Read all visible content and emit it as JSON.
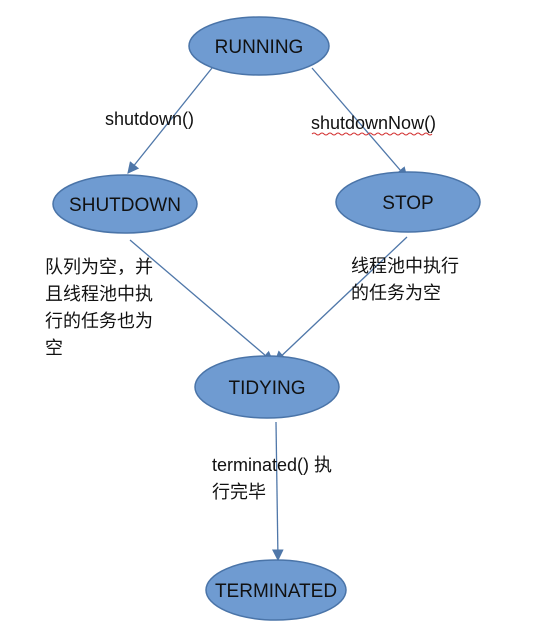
{
  "diagram": {
    "nodes": {
      "running": "RUNNING",
      "shutdown": "SHUTDOWN",
      "stop": "STOP",
      "tidying": "TIDYING",
      "terminated": "TERMINATED"
    },
    "edges": {
      "running_to_shutdown": "shutdown()",
      "running_to_stop": "shutdownNow()",
      "shutdown_to_tidying": [
        "队列为空，并",
        "且线程池中执",
        "行的任务也为",
        "空"
      ],
      "stop_to_tidying": [
        "线程池中执行",
        "的任务为空"
      ],
      "tidying_to_terminated": [
        "terminated() 执",
        "行完毕"
      ]
    },
    "colors": {
      "node_fill": "#6f9bd1",
      "node_stroke": "#4a74a8",
      "edge": "#4f77a9",
      "spellcheck_underline": "#d23030"
    }
  }
}
